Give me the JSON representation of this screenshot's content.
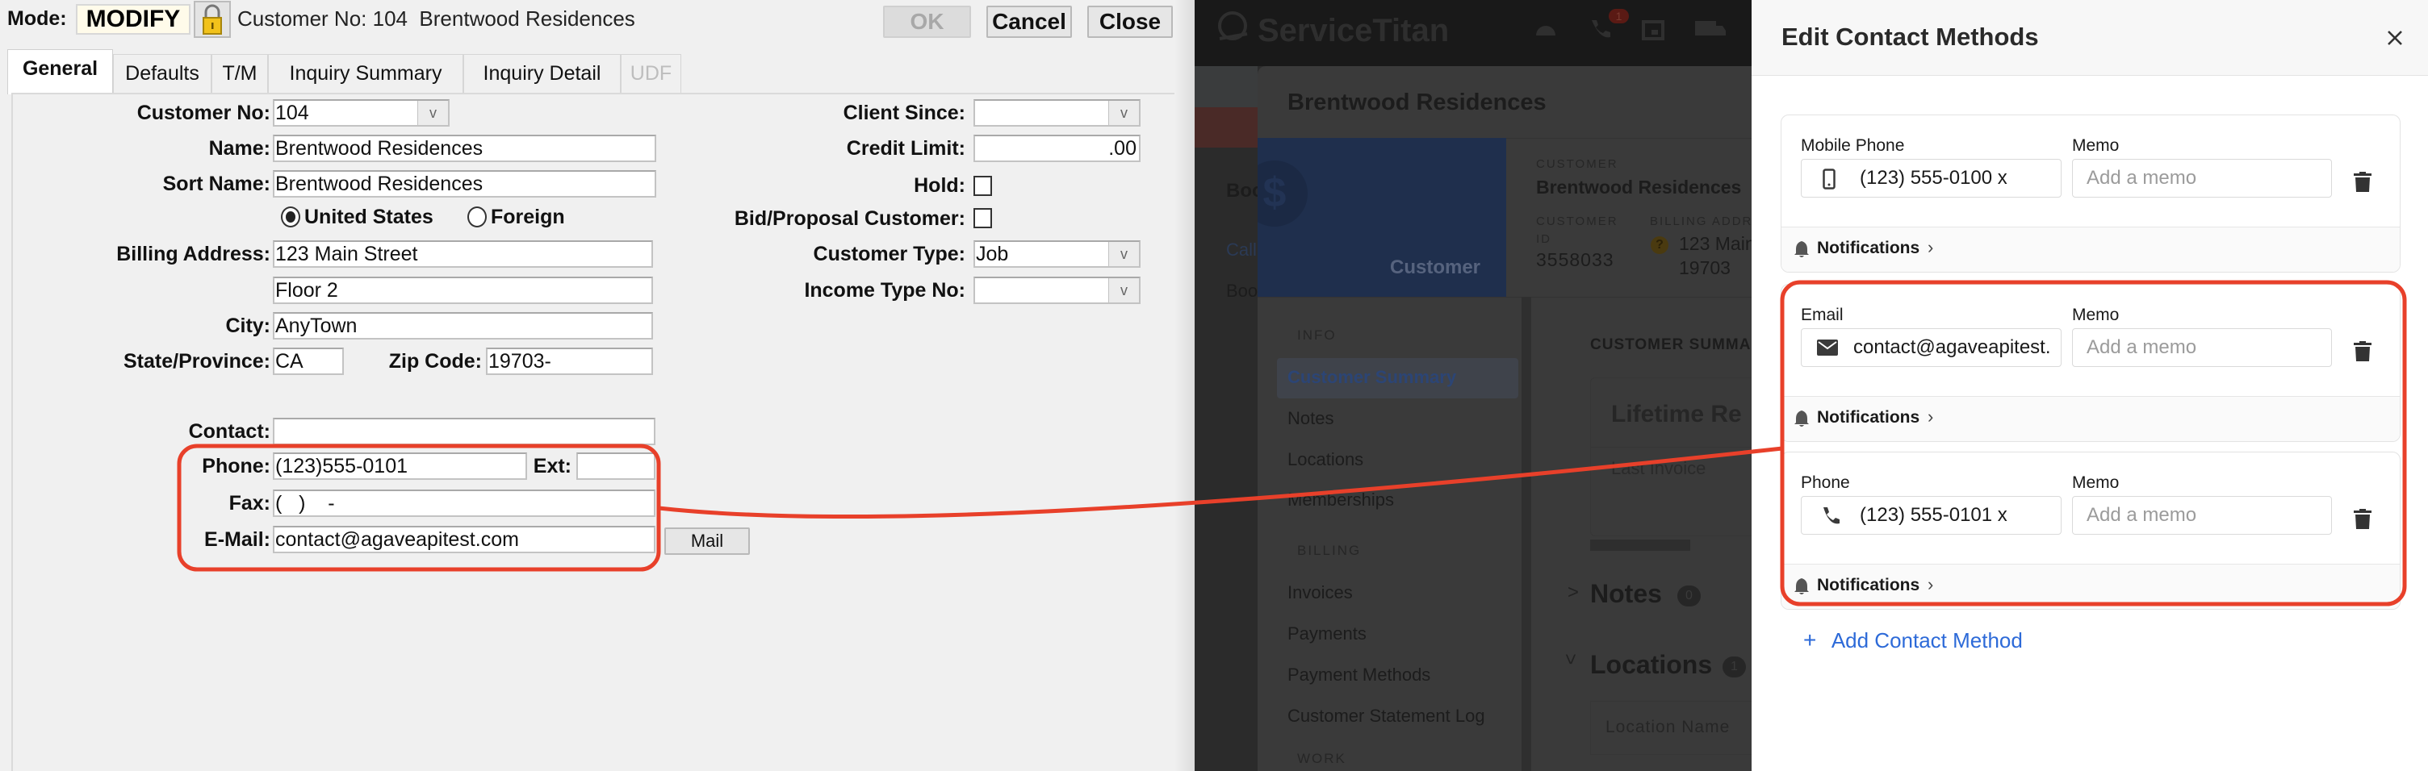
{
  "legacy": {
    "mode_label": "Mode:",
    "mode_value": "MODIFY",
    "header_text": "Customer No: 104  Brentwood Residences",
    "buttons": {
      "ok": "OK",
      "cancel": "Cancel",
      "close": "Close",
      "mail": "Mail"
    },
    "tabs": [
      {
        "label": "General",
        "state": "active"
      },
      {
        "label": "Defaults"
      },
      {
        "label": "T/M"
      },
      {
        "label": "Inquiry Summary"
      },
      {
        "label": "Inquiry Detail"
      },
      {
        "label": "UDF",
        "state": "disabled"
      }
    ],
    "fields": {
      "customer_no": {
        "label": "Customer No:",
        "value": "104"
      },
      "name": {
        "label": "Name:",
        "value": "Brentwood Residences"
      },
      "sort_name": {
        "label": "Sort Name:",
        "value": "Brentwood Residences"
      },
      "country": {
        "options": [
          "United States",
          "Foreign"
        ],
        "selected": "United States"
      },
      "billing_address": {
        "label": "Billing Address:",
        "line1": "123 Main Street",
        "line2": "Floor 2"
      },
      "city": {
        "label": "City:",
        "value": "AnyTown"
      },
      "state": {
        "label": "State/Province:",
        "value": "CA"
      },
      "zip": {
        "label": "Zip Code:",
        "value": "19703-"
      },
      "contact": {
        "label": "Contact:",
        "value": ""
      },
      "phone": {
        "label": "Phone:",
        "value": "(123)555-0101"
      },
      "ext": {
        "label": "Ext:",
        "value": ""
      },
      "fax": {
        "label": "Fax:",
        "value": "(   )    -"
      },
      "email": {
        "label": "E-Mail:",
        "value": "contact@agaveapitest.com"
      },
      "client_since": {
        "label": "Client Since:",
        "value": ""
      },
      "credit_limit": {
        "label": "Credit Limit:",
        "value": ".00"
      },
      "hold": {
        "label": "Hold:",
        "checked": false
      },
      "bid_proposal": {
        "label": "Bid/Proposal Customer:",
        "checked": false
      },
      "customer_type": {
        "label": "Customer Type:",
        "value": "Job"
      },
      "income_type_no": {
        "label": "Income Type No:",
        "value": ""
      }
    }
  },
  "servicetitan": {
    "logo": "ServiceTitan",
    "phone_badge": "1",
    "side_partial": [
      "Boo",
      "Call",
      "Book"
    ],
    "modal_title": "Brentwood Residences",
    "card_label": "Customer",
    "customer_label": "CUSTOMER",
    "customer_name": "Brentwood Residences",
    "customer_id_label_1": "CUSTOMER",
    "customer_id_label_2": "ID",
    "customer_id": "3558033",
    "billing_label": "BILLING ADDRES",
    "billing_line1": "123 Main",
    "billing_line2": "19703",
    "nav": {
      "info_header": "INFO",
      "info_items": [
        "Customer Summary",
        "Notes",
        "Locations",
        "Memberships"
      ],
      "billing_header": "BILLING",
      "billing_items": [
        "Invoices",
        "Payments",
        "Payment Methods",
        "Customer Statement Log"
      ],
      "work_header": "WORK",
      "active": "Customer Summary"
    },
    "summary_title": "CUSTOMER SUMMAR",
    "lifetime": "Lifetime Re",
    "last_invoice": "Last Invoice",
    "notes": {
      "label": "Notes",
      "count": "0"
    },
    "locations": {
      "label": "Locations",
      "count": "1"
    },
    "location_col": "Location Name"
  },
  "drawer": {
    "title": "Edit Contact Methods",
    "memo_label": "Memo",
    "memo_placeholder": "Add a memo",
    "notifications_label": "Notifications",
    "methods": [
      {
        "type": "Mobile Phone",
        "icon": "mobile-phone-icon",
        "value": "(123) 555-0100 x"
      },
      {
        "type": "Email",
        "icon": "envelope-icon",
        "value": "contact@agaveapitest."
      },
      {
        "type": "Phone",
        "icon": "phone-icon",
        "value": "(123) 555-0101 x"
      }
    ],
    "add_label": "Add Contact Method"
  },
  "colors": {
    "highlight": "#e8402a",
    "link": "#2d6ad8",
    "active_nav": "#2c4575"
  }
}
